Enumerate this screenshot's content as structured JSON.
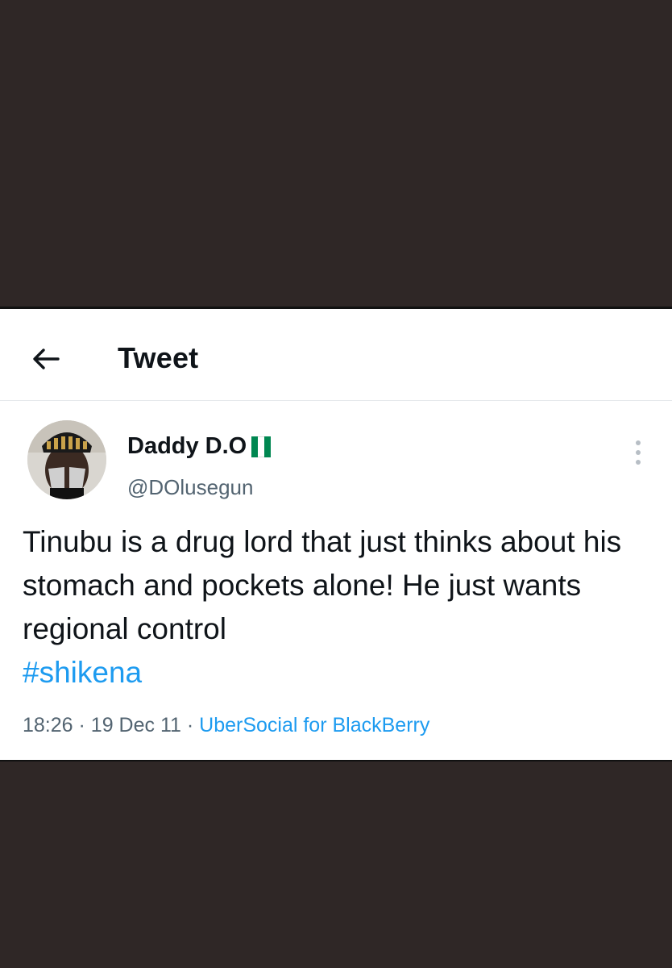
{
  "header": {
    "title": "Tweet",
    "back_icon": "arrow-left-icon"
  },
  "tweet": {
    "display_name": "Daddy D.O",
    "handle": "@DOlusegun",
    "text": "Tinubu is a drug lord that just thinks about his stomach and pockets alone! He just wants regional control",
    "hashtag": "#shikena",
    "time": "18:26",
    "separator": "·",
    "date": "19 Dec 11",
    "source": "UberSocial for BlackBerry"
  },
  "colors": {
    "accent": "#1d9bf0",
    "secondary_text": "#536471",
    "primary_text": "#0f1419",
    "flag_green": "#008751",
    "backdrop": "#2f2726"
  },
  "icons": {
    "more": "more-vertical-icon",
    "flag": "nigeria-flag-icon"
  }
}
